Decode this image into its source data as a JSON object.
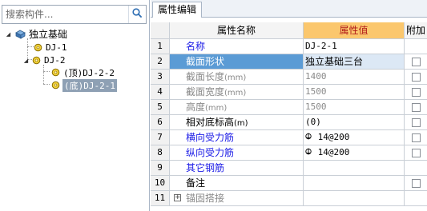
{
  "search": {
    "placeholder": "搜索构件..."
  },
  "tree": {
    "root": {
      "label": "独立基础"
    },
    "dj1": {
      "label": "DJ-1"
    },
    "dj2": {
      "label": "DJ-2"
    },
    "dj2_2": {
      "label": "(顶)DJ-2-2"
    },
    "dj2_1": {
      "label": "(底)DJ-2-1"
    }
  },
  "tab": {
    "label": "属性编辑"
  },
  "table": {
    "headers": {
      "name": "属性名称",
      "value": "属性值",
      "add": "附加"
    },
    "rows": [
      {
        "num": "1",
        "name": "名称",
        "value": "DJ-2-1"
      },
      {
        "num": "2",
        "name": "截面形状",
        "value": "独立基础三台"
      },
      {
        "num": "3",
        "name": "截面长度",
        "unit": "(mm)",
        "value": "1400"
      },
      {
        "num": "4",
        "name": "截面宽度",
        "unit": "(mm)",
        "value": "1500"
      },
      {
        "num": "5",
        "name": "高度",
        "unit": "(mm)",
        "value": "1500"
      },
      {
        "num": "6",
        "name": "相对底标高",
        "unit": "(m)",
        "value": "(0)"
      },
      {
        "num": "7",
        "name": "横向受力筋",
        "value": " 14@200"
      },
      {
        "num": "8",
        "name": "纵向受力筋",
        "value": " 14@200"
      },
      {
        "num": "9",
        "name": "其它钢筋",
        "value": ""
      },
      {
        "num": "10",
        "name": "备注",
        "value": ""
      },
      {
        "num": "11",
        "name": "锚固搭接",
        "value": ""
      }
    ]
  },
  "colors": {
    "header_value_bg": "#fbc76d",
    "header_value_text": "#b01818",
    "selected_name_bg": "#5b9bd5",
    "link_blue": "#1a1ae6"
  }
}
